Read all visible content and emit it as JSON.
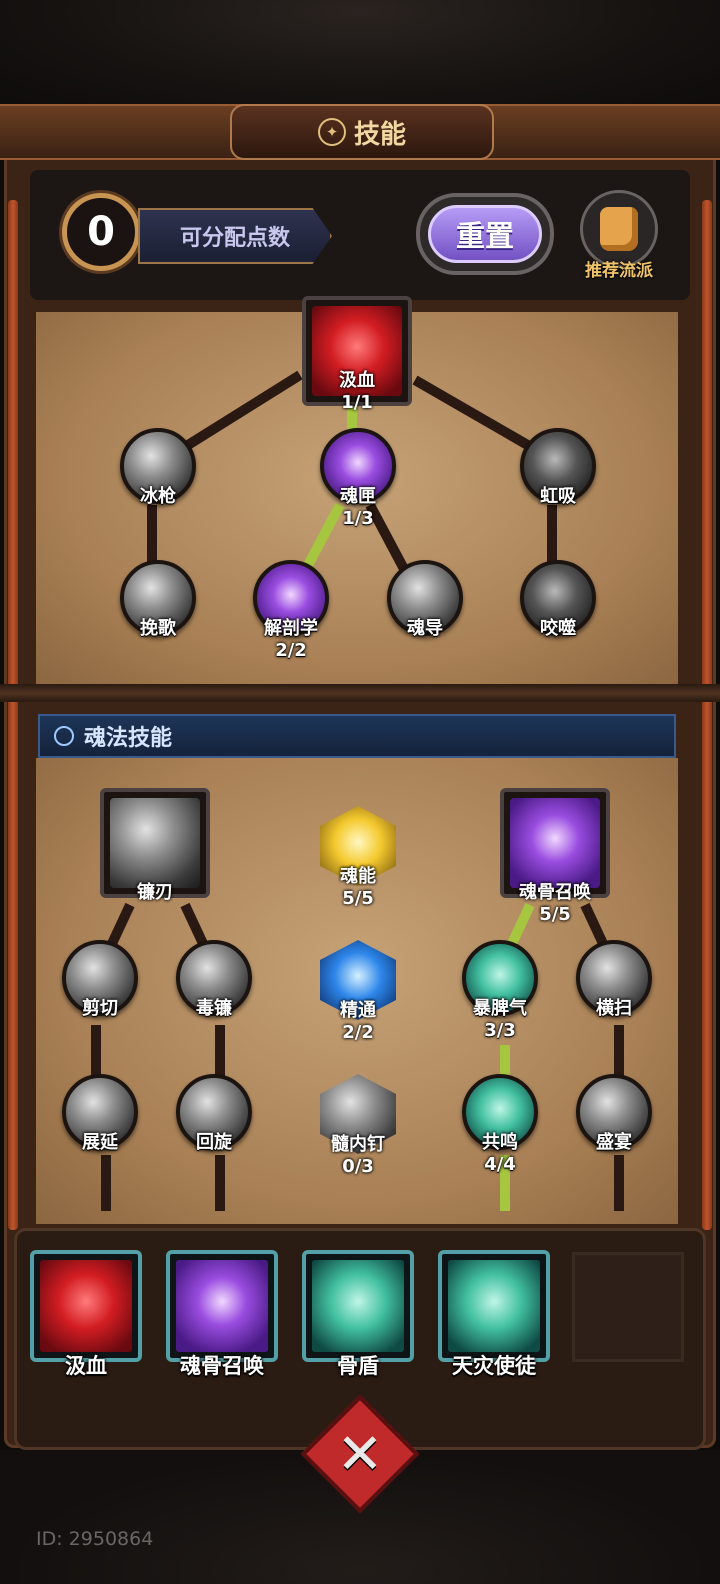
{
  "title": "技能",
  "header": {
    "points_value": "0",
    "points_label": "可分配点数",
    "reset_label": "重置",
    "recommend_label": "推荐流派"
  },
  "tree1": {
    "root": {
      "name": "汲血",
      "level": "1/1"
    },
    "nodes": [
      {
        "name": "冰枪",
        "level": ""
      },
      {
        "name": "魂匣",
        "level": "1/3"
      },
      {
        "name": "虹吸",
        "level": ""
      },
      {
        "name": "挽歌",
        "level": ""
      },
      {
        "name": "解剖学",
        "level": "2/2"
      },
      {
        "name": "魂导",
        "level": ""
      },
      {
        "name": "咬噬",
        "level": ""
      }
    ]
  },
  "section2_title": "魂法技能",
  "tree2": {
    "roots": [
      {
        "name": "镰刃",
        "level": ""
      },
      {
        "name": "魂能",
        "level": "5/5"
      },
      {
        "name": "魂骨召唤",
        "level": "5/5"
      }
    ],
    "nodes": [
      {
        "name": "剪切",
        "level": ""
      },
      {
        "name": "毒镰",
        "level": ""
      },
      {
        "name": "精通",
        "level": "2/2"
      },
      {
        "name": "暴脾气",
        "level": "3/3"
      },
      {
        "name": "横扫",
        "level": ""
      },
      {
        "name": "展延",
        "level": ""
      },
      {
        "name": "回旋",
        "level": ""
      },
      {
        "name": "髓内钉",
        "level": "0/3"
      },
      {
        "name": "共鸣",
        "level": "4/4"
      },
      {
        "name": "盛宴",
        "level": ""
      }
    ]
  },
  "equipped": [
    {
      "name": "汲血"
    },
    {
      "name": "魂骨召唤"
    },
    {
      "name": "骨盾"
    },
    {
      "name": "天灾使徒"
    }
  ],
  "user_id": "ID: 2950864",
  "colors": {
    "active_link": "#a6c63f",
    "reset_purple": "#8e6ad8",
    "slot_border": "#53a0a8",
    "close_red": "#c02a2a"
  }
}
